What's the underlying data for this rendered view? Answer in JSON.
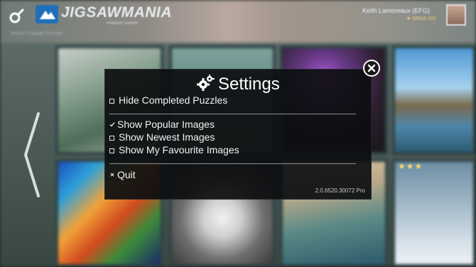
{
  "header": {
    "brand_title": "JIGSAWMANIA",
    "brand_sub": "Platinum Games",
    "user_name": "Keith Lamoreaux (EFG)",
    "user_sub": "★ NINJA 101",
    "subnav_label": "Search Popular Puzzles"
  },
  "settings": {
    "title": "Settings",
    "options": [
      {
        "label": "Hide Completed Puzzles",
        "checked": false
      },
      {
        "label": "Show Popular Images",
        "checked": true
      },
      {
        "label": "Show Newest Images",
        "checked": false
      },
      {
        "label": "Show My Favourite Images",
        "checked": false
      }
    ],
    "quit_label": "Quit",
    "version": "2.0.6520.30072 Pro"
  },
  "puzzle_tiles": [
    {
      "theme": "waterfall-forest",
      "colors": [
        "#a9b5ad",
        "#58715f"
      ]
    },
    {
      "theme": "green-fern",
      "colors": [
        "#6f8f88",
        "#4d6b66"
      ]
    },
    {
      "theme": "purple-flowers",
      "colors": [
        "#3a2740",
        "#5c3d76"
      ]
    },
    {
      "theme": "mountain-lake",
      "colors": [
        "#6eb0d8",
        "#93785b"
      ]
    },
    {
      "theme": "colorful-lion",
      "colors": [
        "#e56a2c",
        "#2c7bcf"
      ]
    },
    {
      "theme": "white-tiger",
      "colors": [
        "#d4d4d4",
        "#4d4d4d"
      ]
    },
    {
      "theme": "coastal-town",
      "colors": [
        "#c7b88f",
        "#5b7f7a"
      ]
    },
    {
      "theme": "ice-castle",
      "colors": [
        "#7f9db1",
        "#bccedb"
      ]
    }
  ],
  "colors": {
    "dialog_bg": "#0c0e10",
    "accent": "#1f6fb8",
    "star": "#f3d86a"
  }
}
